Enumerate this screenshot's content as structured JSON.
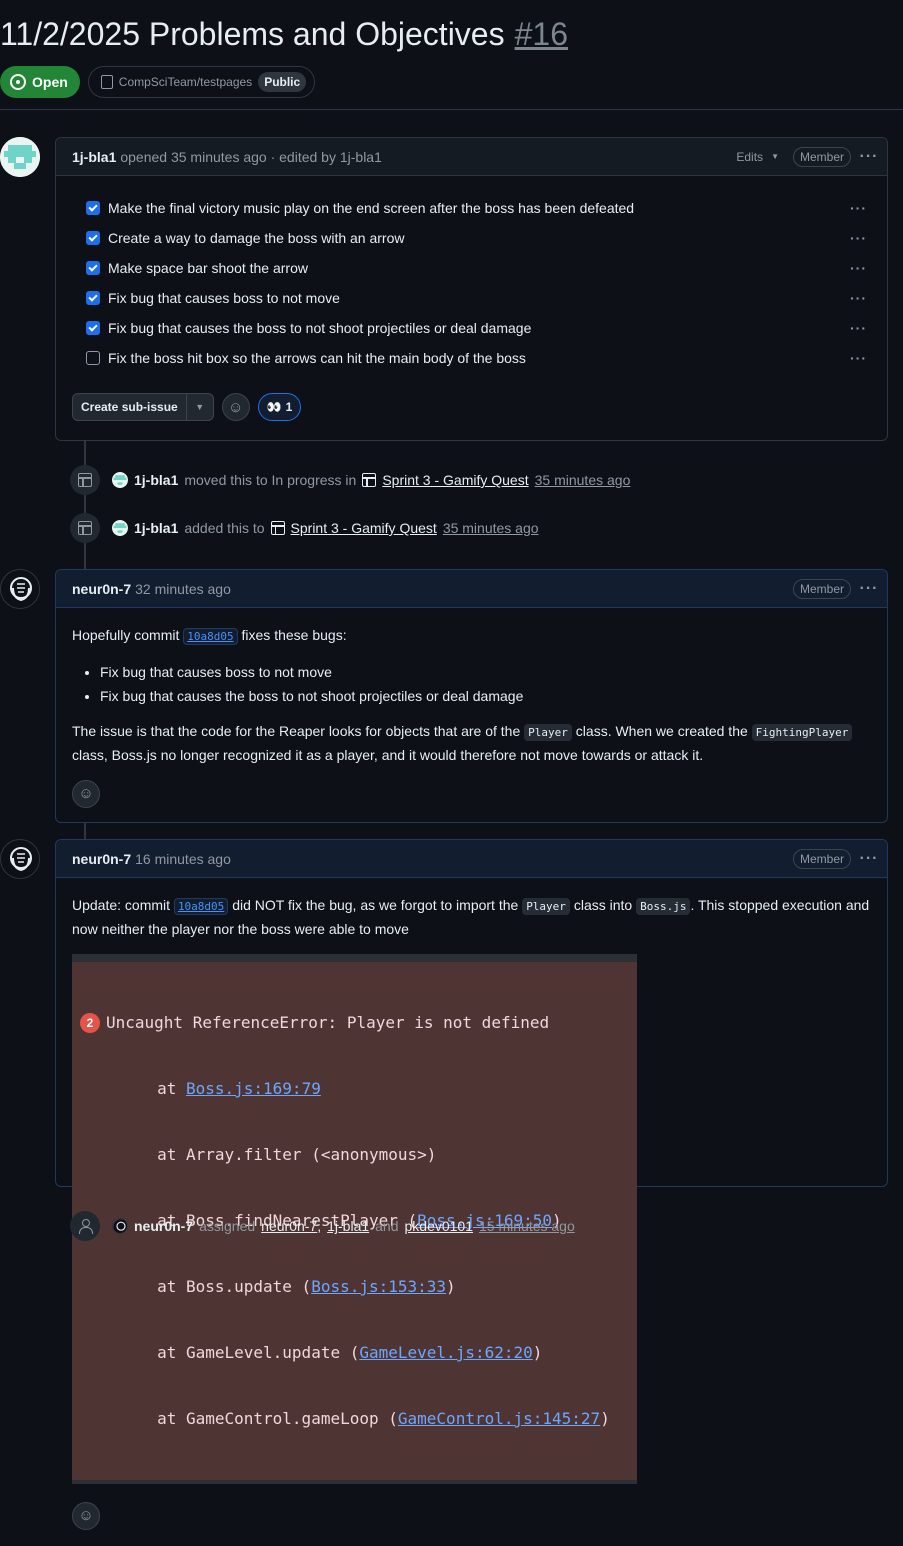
{
  "issue": {
    "title": "11/2/2025 Problems and Objectives",
    "number": "#16",
    "state": "Open",
    "repo": "CompSciTeam/testpages",
    "visibility": "Public"
  },
  "body_comment": {
    "author": "1j-bla1",
    "meta": "opened 35 minutes ago · edited by 1j-bla1",
    "edits_label": "Edits",
    "role": "Member",
    "tasks": [
      {
        "label": "Make the final victory music play on the end screen after the boss has been defeated",
        "checked": true
      },
      {
        "label": "Create a way to damage the boss with an arrow",
        "checked": true
      },
      {
        "label": "Make space bar shoot the arrow",
        "checked": true
      },
      {
        "label": "Fix bug that causes boss to not move",
        "checked": true
      },
      {
        "label": "Fix bug that causes the boss to not shoot projectiles or deal damage",
        "checked": true
      },
      {
        "label": "Fix the boss hit box so the arrows can hit the main body of the boss",
        "checked": false
      }
    ],
    "create_sub_issue": "Create sub-issue",
    "reaction_emoji": "👀",
    "reaction_count": "1"
  },
  "events": [
    {
      "actor": "1j-bla1",
      "action": "moved this to In progress in",
      "project": "Sprint 3 - Gamify Quest",
      "time": "35 minutes ago"
    },
    {
      "actor": "1j-bla1",
      "action": "added this to",
      "project": "Sprint 3 - Gamify Quest",
      "time": "35 minutes ago"
    }
  ],
  "comment1": {
    "author": "neur0n-7",
    "time": "32 minutes ago",
    "role": "Member",
    "p1_pre": "Hopefully commit",
    "commit": "10a8d05",
    "p1_post": "fixes these bugs:",
    "bullets": [
      "Fix bug that causes boss to not move",
      "Fix bug that causes the boss to not shoot projectiles or deal damage"
    ],
    "p2_a": "The issue is that the code for the Reaper looks for objects that are of the",
    "code_player": "Player",
    "p2_b": "class. When we created the",
    "code_fighting": "FightingPlayer",
    "p2_c": "class, Boss.js no longer recognized it as a player, and it would therefore not move towards or attack it."
  },
  "comment2": {
    "author": "neur0n-7",
    "time": "16 minutes ago",
    "role": "Member",
    "p_a": "Update: commit",
    "commit": "10a8d05",
    "p_b": "did NOT fix the bug, as we forgot to import the",
    "code_player": "Player",
    "p_c": "class into",
    "code_boss": "Boss.js",
    "p_d": ". This stopped execution and now neither the player nor the boss were able to move",
    "error": {
      "count": "2",
      "message": "Uncaught ReferenceError: Player is not defined",
      "lines": [
        {
          "pre": "    at ",
          "link": "Boss.js:169:79",
          "post": ""
        },
        {
          "pre": "    at Array.filter (<anonymous>)",
          "link": "",
          "post": ""
        },
        {
          "pre": "    at Boss.findNearestPlayer (",
          "link": "Boss.js:169:50",
          "post": ")"
        },
        {
          "pre": "    at Boss.update (",
          "link": "Boss.js:153:33",
          "post": ")"
        },
        {
          "pre": "    at GameLevel.update (",
          "link": "GameLevel.js:62:20",
          "post": ")"
        },
        {
          "pre": "    at GameControl.gameLoop (",
          "link": "GameControl.js:145:27",
          "post": ")"
        }
      ]
    }
  },
  "assign_event": {
    "actor": "neur0n-7",
    "action": "assigned",
    "assignee1": "neur0n-7",
    "sep1": ",",
    "assignee2": "1j-bla1",
    "and": "and",
    "assignee3": "pkdev0101",
    "time": "15 minutes ago"
  },
  "colors": {
    "open": "#238636",
    "link": "#4493f8",
    "bg": "#0d1117",
    "border": "#30363d"
  }
}
